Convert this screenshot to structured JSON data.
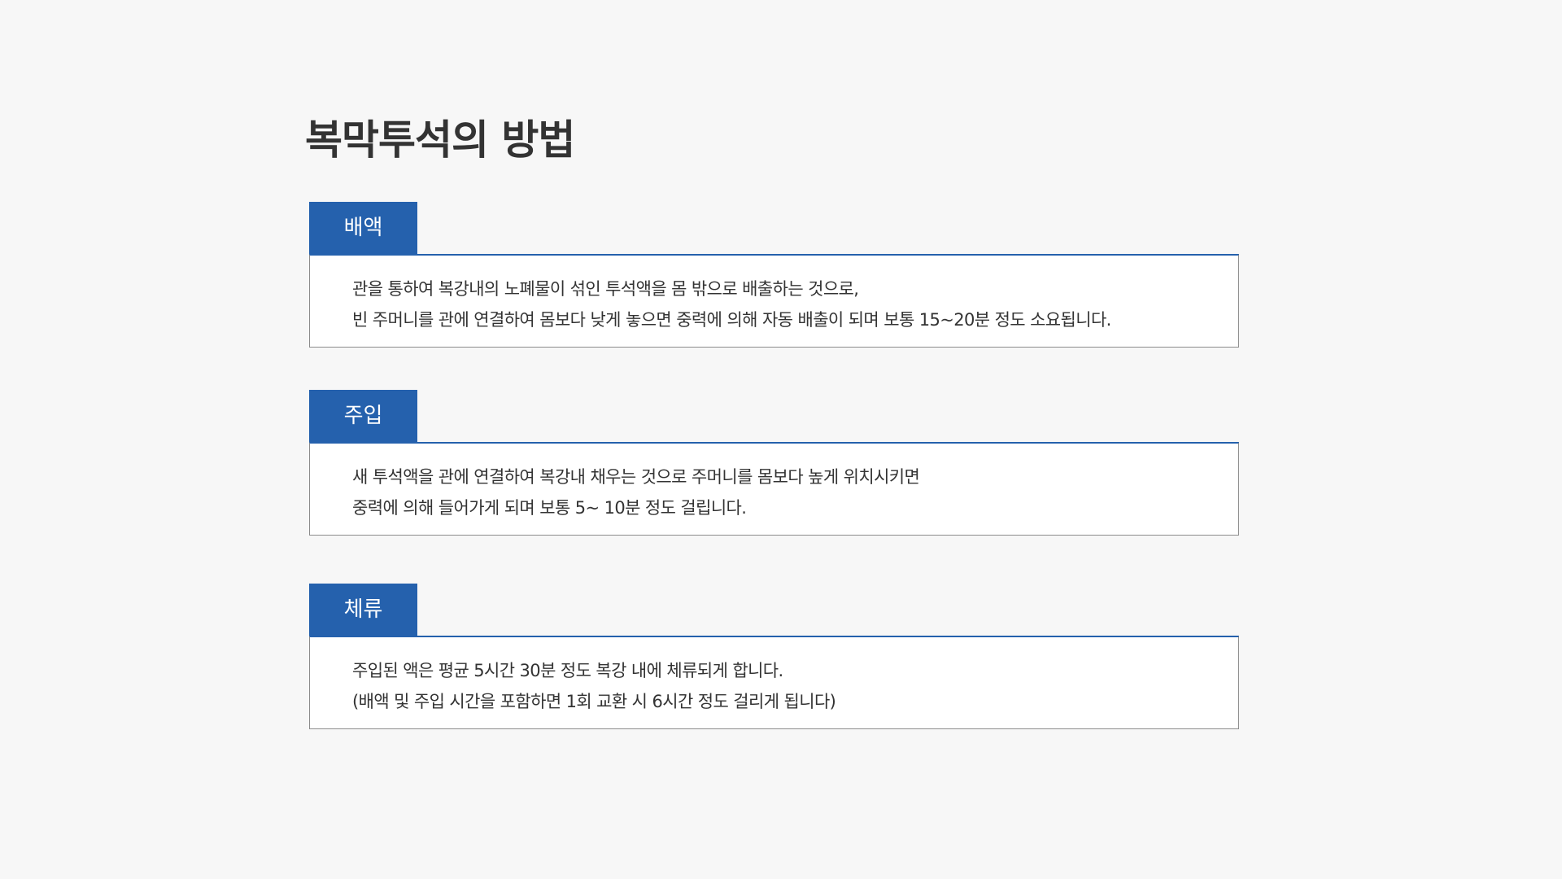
{
  "page": {
    "title": "복막투석의 방법"
  },
  "sections": [
    {
      "label": "배액",
      "lines": [
        "관을 통하여 복강내의 노폐물이 섞인 투석액을 몸 밖으로 배출하는 것으로,",
        "빈 주머니를 관에 연결하여 몸보다 낮게 놓으면 중력에 의해 자동 배출이 되며 보통 15~20분 정도 소요됩니다."
      ]
    },
    {
      "label": "주입",
      "lines": [
        "새 투석액을 관에 연결하여 복강내 채우는 것으로 주머니를 몸보다 높게 위치시키면",
        "중력에 의해 들어가게 되며 보통 5~ 10분 정도 걸립니다."
      ]
    },
    {
      "label": "체류",
      "lines": [
        "주입된 액은 평균 5시간 30분 정도 복강 내에 체류되게 합니다.",
        "(배액 및 주입 시간을 포함하면 1회 교환 시 6시간 정도 걸리게 됩니다)"
      ]
    }
  ],
  "colors": {
    "accent": "#2561ad",
    "background": "#f7f7f7",
    "text": "#333333"
  }
}
